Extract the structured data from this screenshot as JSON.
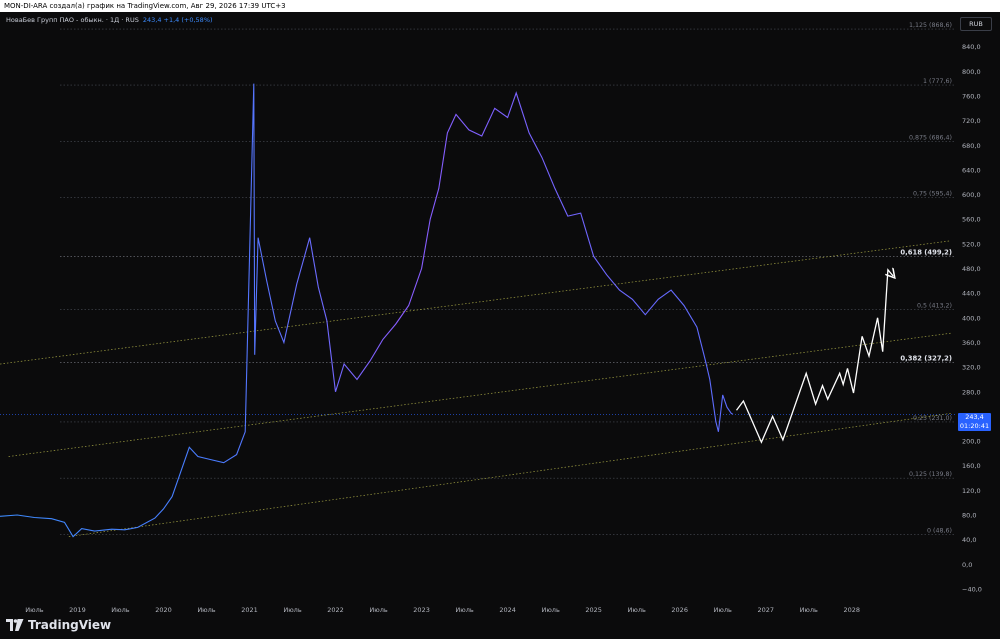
{
  "header": {
    "text": "MON-DI-ARA создал(а) график на TradingView.com, Авг 29, 2026 17:39 UTC+3"
  },
  "symbol": {
    "name": "НоваБев Групп ПАО - обыкн. · 1Д · RUS",
    "value": "243,4 +1,4 (+0,58%)"
  },
  "currency": "RUB",
  "price_badge": {
    "price": "243,4",
    "timer": "01:20:41"
  },
  "footer": {
    "brand": "TradingView"
  },
  "colors": {
    "background": "#0b0b0c",
    "line_start": "#3d8bfd",
    "line_end": "#b04dff",
    "forecast": "#ffffff",
    "channel": "#a0a043",
    "fib": "#5a5d66",
    "badge": "#2962ff"
  },
  "chart_data": {
    "type": "line",
    "y_axis": {
      "range": [
        -40,
        880
      ],
      "ticks": [
        -40,
        0,
        40,
        80,
        120,
        160,
        200,
        240,
        280,
        320,
        360,
        400,
        440,
        480,
        520,
        560,
        600,
        640,
        680,
        720,
        760,
        800,
        840
      ],
      "tick_labels": [
        "−40,0",
        "0,0",
        "40,0",
        "80,0",
        "120,0",
        "160,0",
        "200,0",
        "240,0",
        "280,0",
        "320,0",
        "360,0",
        "400,0",
        "440,0",
        "480,0",
        "520,0",
        "560,0",
        "600,0",
        "640,0",
        "680,0",
        "720,0",
        "760,0",
        "800,0",
        "840,0"
      ]
    },
    "x_axis": {
      "range": [
        2018.1,
        2029.2
      ],
      "ticks": [
        {
          "t": 2018.5,
          "label": "Июль"
        },
        {
          "t": 2019.0,
          "label": "2019"
        },
        {
          "t": 2019.5,
          "label": "Июль"
        },
        {
          "t": 2020.0,
          "label": "2020"
        },
        {
          "t": 2020.5,
          "label": "Июль"
        },
        {
          "t": 2021.0,
          "label": "2021"
        },
        {
          "t": 2021.5,
          "label": "Июль"
        },
        {
          "t": 2022.0,
          "label": "2022"
        },
        {
          "t": 2022.5,
          "label": "Июль"
        },
        {
          "t": 2023.0,
          "label": "2023"
        },
        {
          "t": 2023.5,
          "label": "Июль"
        },
        {
          "t": 2024.0,
          "label": "2024"
        },
        {
          "t": 2024.5,
          "label": "Июль"
        },
        {
          "t": 2025.0,
          "label": "2025"
        },
        {
          "t": 2025.5,
          "label": "Июль"
        },
        {
          "t": 2026.0,
          "label": "2026"
        },
        {
          "t": 2026.5,
          "label": "Июль"
        },
        {
          "t": 2027.0,
          "label": "2027"
        },
        {
          "t": 2027.5,
          "label": "Июль"
        },
        {
          "t": 2028.0,
          "label": "2028"
        }
      ]
    },
    "fib_levels": [
      {
        "value": 868.6,
        "label": "1,125 (868,6)",
        "bold": false
      },
      {
        "value": 777.6,
        "label": "1 (777,6)",
        "bold": false
      },
      {
        "value": 686.4,
        "label": "0,875 (686,4)",
        "bold": false
      },
      {
        "value": 595.4,
        "label": "0,75 (595,4)",
        "bold": false
      },
      {
        "value": 499.2,
        "label": "0,618 (499,2)",
        "bold": true
      },
      {
        "value": 413.2,
        "label": "0,5 (413,2)",
        "bold": false
      },
      {
        "value": 327.2,
        "label": "0,382 (327,2)",
        "bold": true
      },
      {
        "value": 231.0,
        "label": "0,25 (231,0)",
        "bold": false
      },
      {
        "value": 139.8,
        "label": "0,125 (139,8)",
        "bold": false
      },
      {
        "value": 48.6,
        "label": "0 (48,6)",
        "bold": false
      }
    ],
    "current_price": 243.4,
    "channel_lines": [
      {
        "from": [
          2018.1,
          325
        ],
        "to": [
          2029.15,
          525
        ]
      },
      {
        "from": [
          2018.2,
          175
        ],
        "to": [
          2029.15,
          375
        ]
      },
      {
        "from": [
          2018.9,
          45
        ],
        "to": [
          2029.15,
          245
        ]
      }
    ],
    "series": [
      {
        "points": [
          [
            2018.1,
            78
          ],
          [
            2018.3,
            80
          ],
          [
            2018.5,
            76
          ],
          [
            2018.7,
            74
          ],
          [
            2018.85,
            68
          ],
          [
            2018.95,
            45
          ],
          [
            2019.05,
            58
          ],
          [
            2019.2,
            54
          ],
          [
            2019.4,
            57
          ],
          [
            2019.55,
            56
          ],
          [
            2019.7,
            60
          ],
          [
            2019.9,
            75
          ],
          [
            2020.0,
            90
          ],
          [
            2020.1,
            110
          ],
          [
            2020.2,
            150
          ],
          [
            2020.3,
            190
          ],
          [
            2020.4,
            175
          ],
          [
            2020.55,
            170
          ],
          [
            2020.7,
            165
          ],
          [
            2020.85,
            178
          ],
          [
            2020.95,
            215
          ],
          [
            2021.05,
            780
          ],
          [
            2021.06,
            340
          ],
          [
            2021.1,
            530
          ],
          [
            2021.2,
            460
          ],
          [
            2021.3,
            395
          ],
          [
            2021.4,
            360
          ],
          [
            2021.55,
            455
          ],
          [
            2021.7,
            530
          ],
          [
            2021.8,
            450
          ],
          [
            2021.9,
            395
          ],
          [
            2022.0,
            280
          ],
          [
            2022.1,
            325
          ],
          [
            2022.25,
            300
          ],
          [
            2022.4,
            330
          ],
          [
            2022.55,
            365
          ],
          [
            2022.7,
            390
          ],
          [
            2022.85,
            420
          ],
          [
            2023.0,
            480
          ],
          [
            2023.1,
            560
          ],
          [
            2023.2,
            610
          ],
          [
            2023.3,
            700
          ],
          [
            2023.4,
            730
          ],
          [
            2023.55,
            705
          ],
          [
            2023.7,
            695
          ],
          [
            2023.85,
            740
          ],
          [
            2024.0,
            725
          ],
          [
            2024.1,
            765
          ],
          [
            2024.25,
            700
          ],
          [
            2024.4,
            660
          ],
          [
            2024.55,
            610
          ],
          [
            2024.7,
            565
          ],
          [
            2024.85,
            570
          ],
          [
            2025.0,
            500
          ],
          [
            2025.15,
            470
          ],
          [
            2025.3,
            445
          ],
          [
            2025.45,
            430
          ],
          [
            2025.6,
            405
          ],
          [
            2025.75,
            430
          ],
          [
            2025.9,
            445
          ],
          [
            2026.05,
            420
          ],
          [
            2026.2,
            385
          ],
          [
            2026.3,
            330
          ],
          [
            2026.35,
            300
          ],
          [
            2026.42,
            232
          ],
          [
            2026.45,
            215
          ],
          [
            2026.5,
            275
          ],
          [
            2026.55,
            255
          ],
          [
            2026.6,
            245
          ],
          [
            2026.62,
            243.4
          ]
        ]
      },
      {
        "name": "",
        "points": [
          [
            2026.66,
            250
          ],
          [
            2026.74,
            265
          ],
          [
            2026.95,
            198
          ],
          [
            2027.08,
            240
          ],
          [
            2027.2,
            202
          ],
          [
            2027.47,
            310
          ],
          [
            2027.58,
            260
          ],
          [
            2027.66,
            290
          ],
          [
            2027.72,
            268
          ],
          [
            2027.86,
            310
          ],
          [
            2027.9,
            292
          ],
          [
            2027.95,
            318
          ],
          [
            2028.02,
            278
          ],
          [
            2028.12,
            370
          ],
          [
            2028.2,
            338
          ],
          [
            2028.3,
            400
          ],
          [
            2028.36,
            345
          ],
          [
            2028.42,
            478
          ],
          [
            2028.48,
            468
          ]
        ]
      }
    ]
  }
}
